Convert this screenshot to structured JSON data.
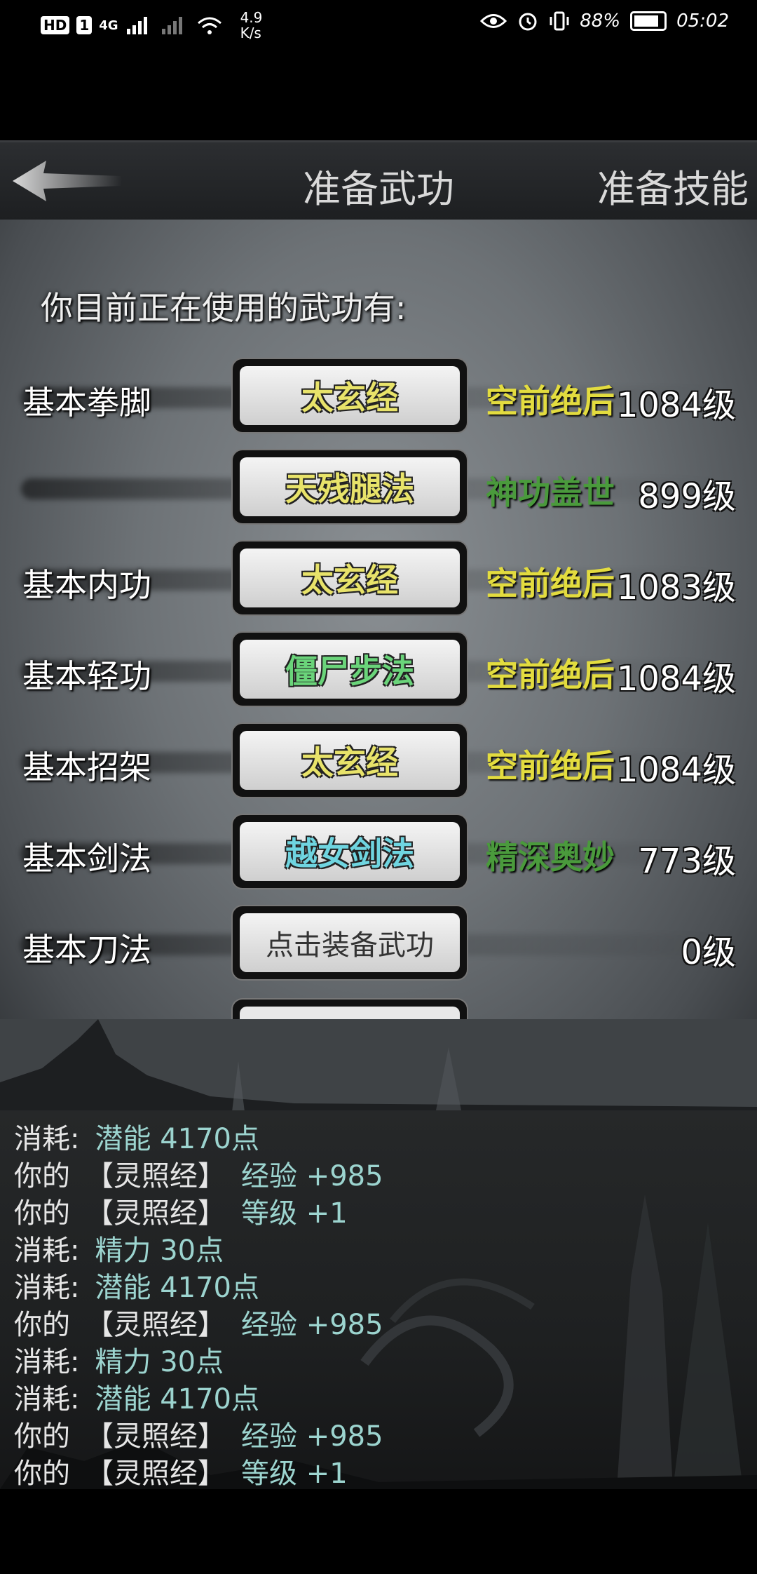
{
  "status_bar": {
    "hd_badge": "HD",
    "sim_badge": "1",
    "network": "4G",
    "speed_value": "4.9",
    "speed_unit": "K/s",
    "battery": "88%",
    "time": "05:02"
  },
  "header": {
    "title": "准备武功",
    "right_button": "准备技能"
  },
  "intro_text": "你目前正在使用的武功有:",
  "rows": [
    {
      "label": "基本拳脚",
      "skill": "太玄经",
      "rank": "空前绝后",
      "level": "1084级"
    },
    {
      "label": "",
      "skill": "天残腿法",
      "rank": "神功盖世",
      "level": "899级"
    },
    {
      "label": "基本内功",
      "skill": "太玄经",
      "rank": "空前绝后",
      "level": "1083级"
    },
    {
      "label": "基本轻功",
      "skill": "僵尸步法",
      "rank": "空前绝后",
      "level": "1084级"
    },
    {
      "label": "基本招架",
      "skill": "太玄经",
      "rank": "空前绝后",
      "level": "1084级"
    },
    {
      "label": "基本剑法",
      "skill": "越女剑法",
      "rank": "精深奥妙",
      "level": "773级"
    },
    {
      "label": "基本刀法",
      "skill": "点击装备武功",
      "rank": "",
      "level": "0级"
    }
  ],
  "log": [
    {
      "prefix": "消耗:",
      "item": "",
      "text": "潜能 4170点"
    },
    {
      "prefix": "你的",
      "item": "【灵照经】",
      "text": "经验 +985"
    },
    {
      "prefix": "你的",
      "item": "【灵照经】",
      "text": "等级 +1"
    },
    {
      "prefix": "消耗:",
      "item": "",
      "text": "精力 30点"
    },
    {
      "prefix": "消耗:",
      "item": "",
      "text": "潜能 4170点"
    },
    {
      "prefix": "你的",
      "item": "【灵照经】",
      "text": "经验 +985"
    },
    {
      "prefix": "消耗:",
      "item": "",
      "text": "精力 30点"
    },
    {
      "prefix": "消耗:",
      "item": "",
      "text": "潜能 4170点"
    },
    {
      "prefix": "你的",
      "item": "【灵照经】",
      "text": "经验 +985"
    },
    {
      "prefix": "你的",
      "item": "【灵照经】",
      "text": "等级 +1"
    }
  ]
}
